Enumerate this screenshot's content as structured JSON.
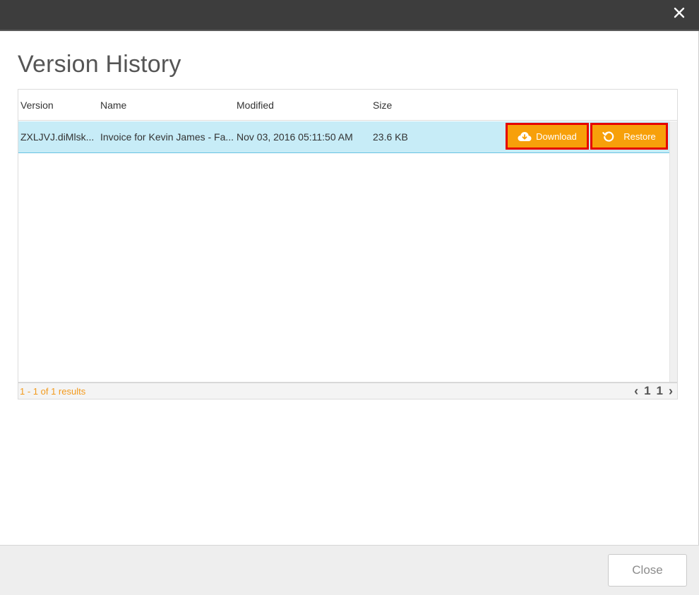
{
  "dialog": {
    "title": "Version History",
    "close_icon": "close-icon"
  },
  "table": {
    "columns": [
      "Version",
      "Name",
      "Modified",
      "Size"
    ],
    "rows": [
      {
        "version": "ZXLJVJ.diMlsk...",
        "name": "Invoice for Kevin James - Fa...",
        "modified": "Nov 03, 2016 05:11:50 AM",
        "size": "23.6 KB",
        "download_label": "Download",
        "restore_label": "Restore"
      }
    ],
    "results_text": "1 - 1 of 1 results",
    "pagination": {
      "prev": "‹",
      "current_page": "1",
      "total_pages": "1",
      "next": "›"
    }
  },
  "footer": {
    "close_label": "Close"
  },
  "colors": {
    "titlebar": "#3d3d3d",
    "selected_row": "#c7ecf7",
    "action_button": "#f7a00a",
    "highlight_border": "#e50000",
    "results_text": "#f39a1c"
  },
  "icons": {
    "download": "cloud-download-icon",
    "restore": "restore-icon"
  }
}
